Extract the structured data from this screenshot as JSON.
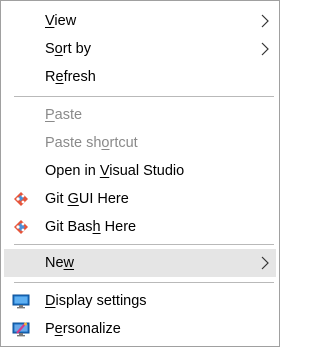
{
  "menu": {
    "items": [
      {
        "id": "view",
        "label": "View",
        "mnemonic_index": 0,
        "submenu": true,
        "disabled": false,
        "icon": null
      },
      {
        "id": "sort-by",
        "label": "Sort by",
        "mnemonic_index": 1,
        "submenu": true,
        "disabled": false,
        "icon": null
      },
      {
        "id": "refresh",
        "label": "Refresh",
        "mnemonic_index": 1,
        "submenu": false,
        "disabled": false,
        "icon": null
      },
      {
        "id": "paste",
        "label": "Paste",
        "mnemonic_index": 0,
        "submenu": false,
        "disabled": true,
        "icon": null
      },
      {
        "id": "paste-shortcut",
        "label": "Paste shortcut",
        "mnemonic_index": 8,
        "submenu": false,
        "disabled": true,
        "icon": null
      },
      {
        "id": "open-in-visual-studio",
        "label": "Open in Visual Studio",
        "mnemonic_index": 8,
        "submenu": false,
        "disabled": false,
        "icon": null
      },
      {
        "id": "git-gui-here",
        "label": "Git GUI Here",
        "mnemonic_index": 4,
        "submenu": false,
        "disabled": false,
        "icon": "git-icon"
      },
      {
        "id": "git-bash-here",
        "label": "Git Bash Here",
        "mnemonic_index": 7,
        "submenu": false,
        "disabled": false,
        "icon": "git-icon"
      },
      {
        "id": "new",
        "label": "New",
        "mnemonic_index": 2,
        "submenu": true,
        "disabled": false,
        "highlighted": true,
        "icon": null
      },
      {
        "id": "display-settings",
        "label": "Display settings",
        "mnemonic_index": 0,
        "submenu": false,
        "disabled": false,
        "icon": "display-settings-icon"
      },
      {
        "id": "personalize",
        "label": "Personalize",
        "mnemonic_index": 1,
        "submenu": false,
        "disabled": false,
        "icon": "personalize-icon"
      }
    ]
  },
  "colors": {
    "highlight": "#e5e5e5",
    "disabled_text": "#8a8a8a",
    "separator": "#b9b9b9",
    "border": "#a0a0a0"
  }
}
